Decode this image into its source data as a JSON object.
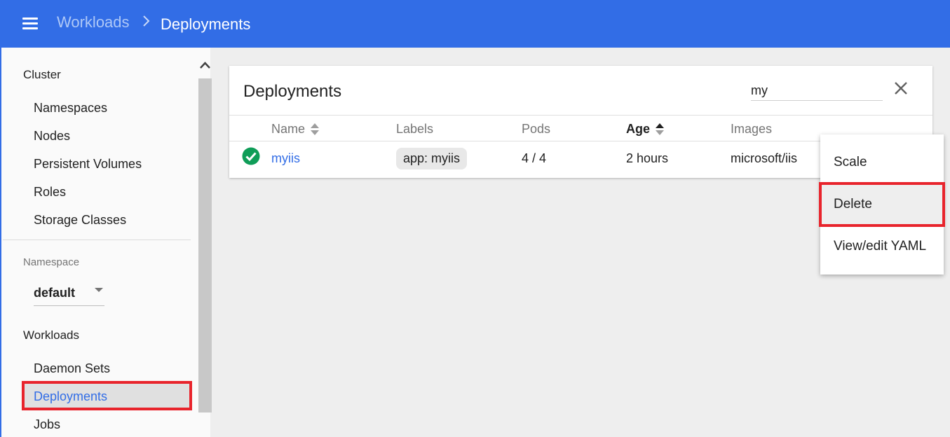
{
  "header": {
    "breadcrumb_parent": "Workloads",
    "breadcrumb_current": "Deployments",
    "bar_color": "#326de6"
  },
  "sidebar": {
    "cluster_title": "Cluster",
    "cluster_items": [
      "Namespaces",
      "Nodes",
      "Persistent Volumes",
      "Roles",
      "Storage Classes"
    ],
    "namespace_label": "Namespace",
    "namespace_value": "default",
    "workloads_title": "Workloads",
    "workload_items": [
      "Daemon Sets",
      "Deployments",
      "Jobs"
    ],
    "active_item": "Deployments"
  },
  "card": {
    "title": "Deployments",
    "search_value": "my",
    "columns": [
      "Name",
      "Labels",
      "Pods",
      "Age",
      "Images"
    ],
    "sorted_column": "Age",
    "rows": [
      {
        "status": "check-circle-icon",
        "name": "myiis",
        "label": "app: myiis",
        "pods": "4 / 4",
        "age": "2 hours",
        "image": "microsoft/iis"
      }
    ]
  },
  "context_menu": {
    "items": [
      "Scale",
      "Delete",
      "View/edit YAML"
    ],
    "highlighted": "Delete"
  },
  "colors": {
    "accent": "#326de6",
    "highlight_outline": "#e8242c",
    "status_ok": "#0f9d58"
  }
}
